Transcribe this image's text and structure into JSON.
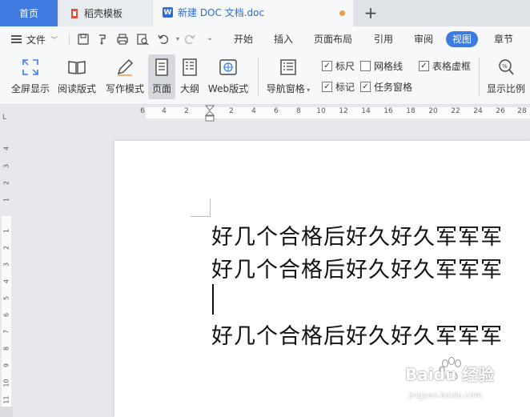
{
  "tabs": {
    "home": "首页",
    "template": "稻壳模板",
    "document": "新建 DOC 文档.doc",
    "new_tab_icon": "plus-icon"
  },
  "menu": {
    "file": "文件",
    "items": [
      "开始",
      "插入",
      "页面布局",
      "引用",
      "审阅",
      "视图",
      "章节"
    ],
    "active": "视图"
  },
  "ribbon": {
    "fullscreen": "全屏显示",
    "read_mode": "阅读版式",
    "write_mode": "写作模式",
    "page": "页面",
    "outline": "大纲",
    "web": "Web版式",
    "nav_pane": "导航窗格",
    "ruler": "标尺",
    "gridlines": "网格线",
    "table_gridlines": "表格虚框",
    "marks": "标记",
    "task_pane": "任务窗格",
    "zoom": "显示比例",
    "checks": {
      "ruler": true,
      "gridlines": false,
      "table_gridlines": true,
      "marks": true,
      "task_pane": true
    }
  },
  "ruler": {
    "h_ticks": [
      "6",
      "4",
      "2",
      "2",
      "4",
      "6",
      "8",
      "10",
      "12",
      "14",
      "16",
      "18",
      "20",
      "22",
      "24",
      "26",
      "28"
    ],
    "v_ticks": [
      "4",
      "3",
      "2",
      "1",
      "1",
      "2",
      "3",
      "4",
      "5",
      "6",
      "7",
      "8",
      "9",
      "10",
      "11"
    ],
    "corner": "L"
  },
  "document": {
    "lines": [
      "好几个合格后好久好久军军军",
      "好几个合格后好久好久军军军",
      "好几个合格后好久好久军军军"
    ]
  },
  "watermark": {
    "brand": "Baidu 经验",
    "url": "jingyan.baidu.com"
  },
  "colors": {
    "accent": "#3f7ae0",
    "tab_home": "#3f7ae0",
    "dot": "#f09a4c"
  }
}
